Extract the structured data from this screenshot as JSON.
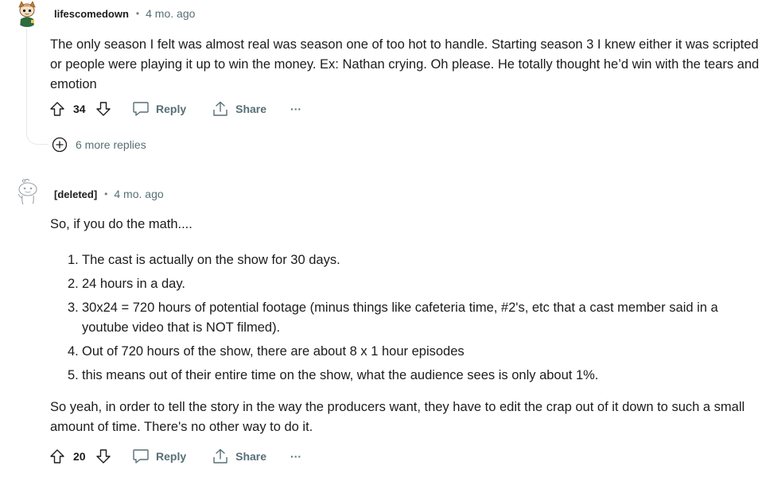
{
  "comments": [
    {
      "author": "lifescomedown",
      "separator": "•",
      "time": "4 mo. ago",
      "paragraphs": [
        "The only season I felt was almost real was season one of too hot to handle. Starting season 3 I knew either it was scripted or people were playing it up to win the money. Ex: Nathan crying. Oh please. He totally thought he’d win with the tears and emotion"
      ],
      "votes": "34",
      "reply_label": "Reply",
      "share_label": "Share",
      "more_label": "···",
      "more_replies": "6 more replies"
    },
    {
      "author": "[deleted]",
      "separator": "•",
      "time": "4 mo. ago",
      "intro": "So, if you do the math....",
      "list": [
        {
          "num": "1.",
          "text": "The cast is actually on the show for 30 days."
        },
        {
          "num": "2.",
          "text": "24 hours in a day."
        },
        {
          "num": "3.",
          "text": "30x24 = 720 hours of potential footage (minus things like cafeteria time, #2's, etc that a cast member said in a youtube video that is NOT filmed)."
        },
        {
          "num": "4.",
          "text": "Out of 720 hours of the show, there are about 8 x 1 hour episodes"
        },
        {
          "num": "5.",
          "text": "this means out of their entire time on the show, what the audience sees is only about 1%."
        }
      ],
      "outro": "So yeah, in order to tell the story in the way the producers want, they have to edit the crap out of it down to such a small amount of time. There's no other way to do it.",
      "votes": "20",
      "reply_label": "Reply",
      "share_label": "Share",
      "more_label": "···"
    }
  ],
  "icons": {
    "upvote": "upvote-arrow-icon",
    "downvote": "downvote-arrow-icon",
    "reply": "speech-bubble-icon",
    "share": "share-arrow-icon",
    "expand": "plus-circle-icon"
  }
}
